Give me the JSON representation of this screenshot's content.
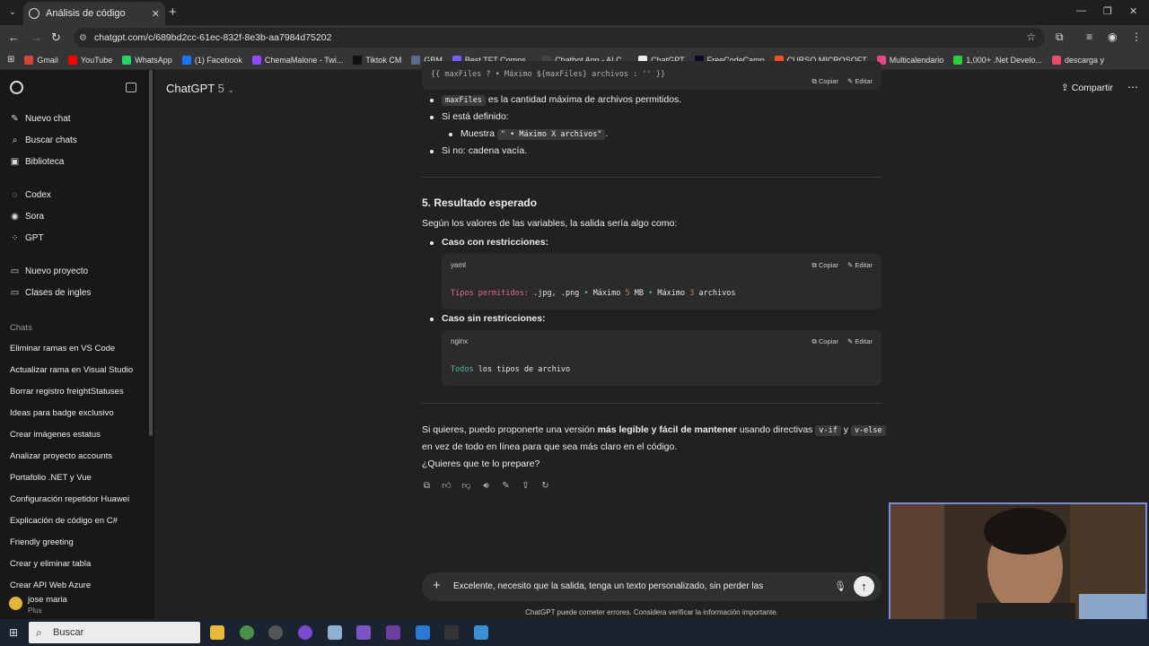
{
  "browser": {
    "tab_title": "Análisis de código",
    "url": "chatgpt.com/c/689bd2cc-61ec-832f-8e3b-aa7984d75202",
    "bookmarks": [
      {
        "label": "Gmail",
        "color": "#d44638"
      },
      {
        "label": "YouTube",
        "color": "#ff0000"
      },
      {
        "label": "WhatsApp",
        "color": "#25d366"
      },
      {
        "label": "(1) Facebook",
        "color": "#1877f2"
      },
      {
        "label": "ChemaMalone - Twi...",
        "color": "#9146ff"
      },
      {
        "label": "Tiktok CM",
        "color": "#111111"
      },
      {
        "label": "GBM",
        "color": "#5a6b8a"
      },
      {
        "label": "Best TFT Comps...",
        "color": "#7a5cff"
      },
      {
        "label": "Chatbot App - AI C...",
        "color": "#444444"
      },
      {
        "label": "ChatGPT",
        "color": "#ececec"
      },
      {
        "label": "FreeCodeCamp",
        "color": "#0a0a23"
      },
      {
        "label": "CURSO MICROSOFT",
        "color": "#f25022"
      },
      {
        "label": "Multicalendario",
        "color": "#e8478b"
      },
      {
        "label": "1,000+ .Net Develo...",
        "color": "#2ecc40"
      },
      {
        "label": "descarga y",
        "color": "#e84b6a"
      }
    ]
  },
  "sidebar": {
    "nav": [
      {
        "label": "Nuevo chat",
        "icon": "edit-icon"
      },
      {
        "label": "Buscar chats",
        "icon": "search-icon"
      },
      {
        "label": "Biblioteca",
        "icon": "library-icon"
      },
      {
        "label": "Codex",
        "icon": "codex-icon"
      },
      {
        "label": "Sora",
        "icon": "sora-icon"
      },
      {
        "label": "GPT",
        "icon": "gpt-icon"
      },
      {
        "label": "Nuevo proyecto",
        "icon": "folder-icon"
      },
      {
        "label": "Clases de ingles",
        "icon": "folder-icon"
      }
    ],
    "chats_heading": "Chats",
    "chats": [
      "Eliminar ramas en VS Code",
      "Actualizar rama en Visual Studio",
      "Borrar registro freightStatuses",
      "Ideas para badge exclusivo",
      "Crear imágenes estatus",
      "Analizar proyecto accounts",
      "Portafolio .NET y Vue",
      "Configuración repetidor Huawei",
      "Explicación de código en C#",
      "Friendly greeting",
      "Crear y eliminar tabla",
      "Crear API Web Azure"
    ],
    "user": {
      "name": "jose maria",
      "plan": "Plus"
    }
  },
  "header": {
    "model": "ChatGPT",
    "version": "5",
    "share": "Compartir"
  },
  "message": {
    "top_code": "{{ maxFiles ?   • Máximo ${maxFiles} archivos : '' }}",
    "copy": "Copiar",
    "edit": "Editar",
    "b1_code": "maxFiles",
    "b1_text": "es la cantidad máxima de archivos permitidos.",
    "b2": "Si está definido:",
    "b2_sub_prefix": "Muestra",
    "b2_sub_code": "\" • Máximo X archivos\"",
    "b3": "Si no: cadena vacía.",
    "section_title": "5. Resultado esperado",
    "intro": "Según los valores de las variables, la salida sería algo como:",
    "case1_label": "Caso con restricciones:",
    "case1_lang": "yaml",
    "case1_code": "Tipos permitidos: .jpg, .png • Máximo 5 MB • Máximo 3 archivos",
    "case2_label": "Caso sin restricciones:",
    "case2_lang": "nginx",
    "case2_code": "Todos los tipos de archivo",
    "closing_1a": "Si quieres, puedo proponerte una versión",
    "closing_1b": "más legible y fácil de mantener",
    "closing_1c": "usando directivas",
    "closing_code1": "v-if",
    "closing_y": "y",
    "closing_code2": "v-else",
    "closing_2": "en vez de todo en línea para que sea más claro en el código.",
    "closing_3": "¿Quieres que te lo prepare?"
  },
  "composer": {
    "text": "Excelente, necesito que la salida, tenga un texto personalizado, sin perder las",
    "disclaimer": "ChatGPT puede cometer errores. Considera verificar la información importante."
  },
  "taskbar": {
    "search_label": "Buscar"
  }
}
